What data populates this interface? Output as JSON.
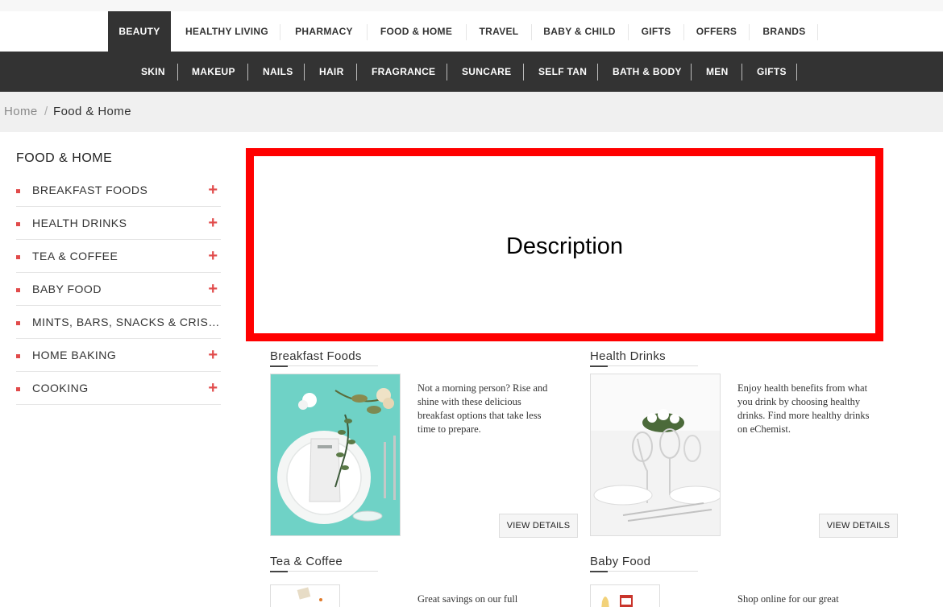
{
  "main_nav": {
    "items": [
      "BEAUTY",
      "HEALTHY LIVING",
      "PHARMACY",
      "FOOD & HOME",
      "TRAVEL",
      "BABY & CHILD",
      "GIFTS",
      "OFFERS",
      "BRANDS"
    ],
    "active": "BEAUTY"
  },
  "sub_nav": {
    "items": [
      "SKIN",
      "MAKEUP",
      "NAILS",
      "HAIR",
      "FRAGRANCE",
      "SUNCARE",
      "SELF TAN",
      "BATH & BODY",
      "MEN",
      "GIFTS"
    ]
  },
  "breadcrumb": {
    "home": "Home",
    "separator": "/",
    "current": "Food & Home"
  },
  "sidebar": {
    "title": "FOOD & HOME",
    "items": [
      {
        "label": "BREAKFAST FOODS",
        "expand": "+"
      },
      {
        "label": "HEALTH DRINKS",
        "expand": "+"
      },
      {
        "label": "TEA & COFFEE",
        "expand": "+"
      },
      {
        "label": "BABY FOOD",
        "expand": "+"
      },
      {
        "label": "MINTS, BARS, SNACKS & CRISP...",
        "expand": ""
      },
      {
        "label": "HOME BAKING",
        "expand": "+"
      },
      {
        "label": "COOKING",
        "expand": "+"
      }
    ]
  },
  "description_box": {
    "label": "Description",
    "border_color": "#ff0000"
  },
  "categories": [
    {
      "title": "Breakfast Foods",
      "description": "Not a morning person? Rise and shine with these delicious breakfast options that take less time to prepare.",
      "button": "VIEW DETAILS"
    },
    {
      "title": "Health Drinks",
      "description": "Enjoy health benefits from what you drink by choosing healthy drinks. Find more healthy drinks on eChemist.",
      "button": "VIEW DETAILS"
    },
    {
      "title": "Tea & Coffee",
      "description": "Great savings on our full",
      "button": ""
    },
    {
      "title": "Baby Food",
      "description": "Shop online for our great",
      "button": ""
    }
  ],
  "colors": {
    "dark_bar": "#333333",
    "accent_red": "#e14b4b",
    "breadcrumb_bg": "#f0f0f0"
  }
}
